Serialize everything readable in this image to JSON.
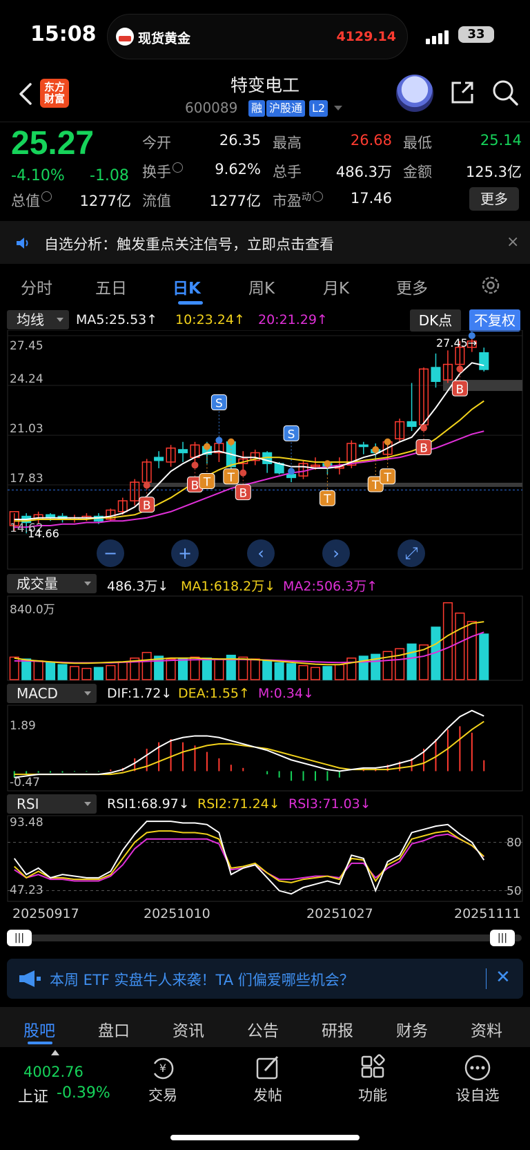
{
  "status_bar": {
    "time": "15:08",
    "ticker_name": "现货黄金",
    "ticker_price": "4129.14",
    "battery": "33"
  },
  "header": {
    "logo_text": "东方财富",
    "stock_name": "特变电工",
    "stock_code": "600089",
    "tags": [
      "融",
      "沪股通",
      "L2"
    ]
  },
  "quote": {
    "price": "25.27",
    "change_pct": "-4.10%",
    "change": "-1.08",
    "fields": [
      {
        "label": "今开",
        "value": "26.35",
        "tone": "white"
      },
      {
        "label": "最高",
        "value": "26.68",
        "tone": "red"
      },
      {
        "label": "最低",
        "value": "25.14",
        "tone": "green"
      },
      {
        "label": "换手",
        "value": "9.62%",
        "tone": "white"
      },
      {
        "label": "总手",
        "value": "486.3万",
        "tone": "white"
      },
      {
        "label": "金额",
        "value": "125.3亿",
        "tone": "white"
      },
      {
        "label": "总值",
        "value": "1277亿",
        "tone": "white"
      },
      {
        "label": "流值",
        "value": "1277亿",
        "tone": "white"
      },
      {
        "label": "市盈",
        "value": "17.46",
        "tone": "white",
        "superscript": "动"
      }
    ],
    "more_label": "更多"
  },
  "alert_banner": {
    "text": "自选分析：触发重点关注信号，立即点击查看",
    "close": "×"
  },
  "period_tabs": [
    "分时",
    "五日",
    "日K",
    "周K",
    "月K",
    "更多"
  ],
  "active_period": "日K",
  "ma_legend": {
    "selector": "均线",
    "ma5": "MA5:25.53↑",
    "ma10": "10:23.24↑",
    "ma20": "20:21.29↑",
    "dk_label": "DK点",
    "fq_label": "不复权"
  },
  "vol_legend": {
    "selector": "成交量",
    "vol": "486.3万↓",
    "ma1": "MA1:618.2万↓",
    "ma2": "MA2:506.3万↑",
    "axis_max": "840.0万"
  },
  "macd_legend": {
    "selector": "MACD",
    "dif": "DIF:1.72↓",
    "dea": "DEA:1.55↑",
    "m": "M:0.34↓",
    "axis_max": "1.89",
    "axis_min": "-0.47"
  },
  "rsi_legend": {
    "selector": "RSI",
    "rsi1": "RSI1:68.97↓",
    "rsi2": "RSI2:71.24↓",
    "rsi3": "RSI3:71.03↓",
    "axis_max": "93.48",
    "axis_min": "47.23",
    "level_high": "80",
    "level_low": "50"
  },
  "date_labels": [
    "20250917",
    "20251010",
    "20251027",
    "20251111"
  ],
  "colors": {
    "up": "#ff3b30",
    "down": "#22d3d3",
    "ma5": "#ffffff",
    "ma10": "#f2d21b",
    "ma20": "#e030d8",
    "accent": "#3c8cff"
  },
  "chart_data": {
    "type": "candlestick",
    "y_ticks": [
      "27.45",
      "24.24",
      "21.03",
      "17.83",
      "14.62"
    ],
    "ylim": [
      14.62,
      27.45
    ],
    "high_marker": "27.45→",
    "low_marker": "14.66",
    "signal_labels": {
      "buy": "B",
      "sell": "S",
      "t": "T"
    },
    "candles": [
      [
        15.2,
        16.1,
        14.8,
        16.0
      ],
      [
        15.8,
        15.4,
        14.7,
        16.0
      ],
      [
        15.6,
        15.9,
        15.3,
        16.1
      ],
      [
        15.9,
        15.7,
        15.5,
        16.0
      ],
      [
        15.8,
        15.6,
        15.4,
        16.0
      ],
      [
        15.6,
        15.7,
        15.4,
        15.9
      ],
      [
        15.7,
        15.8,
        15.5,
        16.0
      ],
      [
        15.8,
        15.5,
        15.3,
        16.0
      ],
      [
        15.6,
        16.2,
        15.5,
        16.3
      ],
      [
        16.1,
        16.8,
        15.9,
        17.0
      ],
      [
        16.8,
        18.0,
        16.5,
        18.2
      ],
      [
        18.0,
        19.3,
        17.8,
        19.5
      ],
      [
        19.6,
        19.4,
        18.9,
        20.0
      ],
      [
        19.3,
        20.2,
        19.0,
        20.4
      ],
      [
        20.1,
        19.9,
        19.3,
        20.6
      ],
      [
        19.6,
        20.4,
        19.1,
        20.6
      ],
      [
        20.3,
        19.8,
        19.2,
        20.6
      ],
      [
        19.9,
        20.5,
        19.3,
        20.7
      ],
      [
        20.6,
        19.0,
        18.8,
        20.7
      ],
      [
        19.2,
        19.5,
        18.6,
        20.0
      ],
      [
        19.4,
        19.9,
        19.1,
        20.1
      ],
      [
        19.9,
        19.2,
        18.6,
        20.0
      ],
      [
        19.2,
        18.6,
        18.5,
        19.3
      ],
      [
        18.5,
        18.3,
        18.0,
        18.7
      ],
      [
        18.4,
        19.2,
        18.2,
        19.4
      ],
      [
        19.1,
        19.1,
        18.8,
        19.6
      ],
      [
        19.2,
        19.0,
        18.5,
        19.4
      ],
      [
        18.9,
        19.0,
        18.5,
        19.6
      ],
      [
        19.1,
        20.5,
        18.9,
        20.7
      ],
      [
        20.4,
        20.3,
        19.8,
        20.6
      ],
      [
        20.1,
        19.9,
        19.4,
        20.5
      ],
      [
        19.8,
        20.6,
        19.5,
        20.8
      ],
      [
        20.8,
        21.9,
        20.6,
        22.1
      ],
      [
        21.9,
        21.6,
        21.3,
        24.4
      ],
      [
        21.7,
        25.3,
        21.5,
        25.4
      ],
      [
        25.4,
        24.5,
        24.1,
        26.3
      ],
      [
        24.6,
        25.6,
        24.4,
        26.5
      ],
      [
        25.6,
        26.7,
        25.3,
        27.1
      ],
      [
        26.7,
        27.1,
        26.4,
        27.45
      ],
      [
        26.35,
        25.27,
        25.14,
        26.68
      ]
    ],
    "ma5": [
      15.6,
      15.6,
      15.7,
      15.7,
      15.7,
      15.7,
      15.7,
      15.7,
      15.8,
      16.0,
      16.4,
      17.1,
      17.9,
      18.7,
      19.2,
      19.6,
      19.9,
      20.0,
      19.8,
      19.6,
      19.6,
      19.4,
      19.2,
      19.0,
      19.0,
      18.9,
      18.9,
      19.0,
      19.3,
      19.6,
      19.8,
      20.2,
      20.6,
      20.9,
      21.8,
      22.8,
      23.9,
      25.0,
      25.7,
      25.53
    ],
    "ma10": [
      15.5,
      15.5,
      15.6,
      15.6,
      15.6,
      15.6,
      15.6,
      15.7,
      15.7,
      15.8,
      15.9,
      16.2,
      16.6,
      17.0,
      17.5,
      18.0,
      18.4,
      18.8,
      19.1,
      19.3,
      19.5,
      19.6,
      19.6,
      19.5,
      19.4,
      19.3,
      19.3,
      19.3,
      19.3,
      19.4,
      19.5,
      19.6,
      19.8,
      20.0,
      20.3,
      20.8,
      21.4,
      22.0,
      22.7,
      23.24
    ],
    "ma20": [
      15.1,
      15.1,
      15.2,
      15.2,
      15.3,
      15.3,
      15.4,
      15.4,
      15.5,
      15.5,
      15.6,
      15.7,
      15.9,
      16.1,
      16.4,
      16.7,
      17.0,
      17.3,
      17.6,
      17.8,
      18.0,
      18.2,
      18.4,
      18.6,
      18.7,
      18.9,
      19.0,
      19.1,
      19.2,
      19.3,
      19.4,
      19.5,
      19.6,
      19.8,
      20.0,
      20.2,
      20.5,
      20.8,
      21.1,
      21.29
    ],
    "volume": [
      240,
      220,
      200,
      190,
      160,
      140,
      120,
      130,
      150,
      190,
      230,
      290,
      250,
      220,
      230,
      240,
      230,
      220,
      260,
      240,
      220,
      200,
      180,
      170,
      150,
      130,
      140,
      160,
      230,
      250,
      270,
      300,
      330,
      380,
      370,
      560,
      820,
      710,
      620,
      486.3
    ],
    "vol_ma1": [
      230,
      210,
      200,
      190,
      180,
      175,
      175,
      180,
      185,
      190,
      200,
      210,
      220,
      230,
      230,
      230,
      225,
      220,
      220,
      220,
      215,
      205,
      195,
      185,
      175,
      165,
      160,
      160,
      180,
      200,
      220,
      240,
      260,
      290,
      320,
      380,
      470,
      540,
      600,
      618.2
    ],
    "vol_ma2": [
      200,
      200,
      195,
      190,
      185,
      180,
      180,
      180,
      180,
      185,
      190,
      195,
      200,
      205,
      210,
      212,
      215,
      215,
      215,
      215,
      212,
      210,
      205,
      200,
      195,
      190,
      185,
      182,
      185,
      190,
      195,
      205,
      215,
      230,
      250,
      290,
      340,
      400,
      460,
      506.3
    ],
    "macd_dif": [
      -0.2,
      -0.15,
      -0.1,
      -0.1,
      -0.1,
      -0.1,
      -0.1,
      -0.1,
      -0.05,
      0.05,
      0.25,
      0.5,
      0.75,
      0.95,
      1.05,
      1.1,
      1.1,
      1.05,
      0.95,
      0.85,
      0.75,
      0.65,
      0.5,
      0.35,
      0.25,
      0.15,
      0.05,
      0.0,
      0.05,
      0.1,
      0.1,
      0.15,
      0.25,
      0.35,
      0.6,
      0.95,
      1.35,
      1.7,
      1.89,
      1.72
    ],
    "macd_dea": [
      -0.1,
      -0.1,
      -0.1,
      -0.1,
      -0.1,
      -0.1,
      -0.1,
      -0.1,
      -0.1,
      -0.05,
      0.05,
      0.15,
      0.3,
      0.45,
      0.6,
      0.7,
      0.8,
      0.85,
      0.85,
      0.8,
      0.75,
      0.7,
      0.6,
      0.5,
      0.4,
      0.3,
      0.2,
      0.1,
      0.05,
      0.05,
      0.05,
      0.05,
      0.1,
      0.15,
      0.25,
      0.45,
      0.7,
      1.0,
      1.3,
      1.55
    ],
    "macd_m": [
      -0.2,
      -0.1,
      -0.05,
      -0.05,
      -0.05,
      -0.02,
      -0.02,
      -0.02,
      0.05,
      0.1,
      0.4,
      0.7,
      0.9,
      1.0,
      0.9,
      0.8,
      0.6,
      0.4,
      0.2,
      0.1,
      0.0,
      -0.1,
      -0.2,
      -0.3,
      -0.3,
      -0.3,
      -0.3,
      -0.2,
      0.0,
      0.1,
      0.1,
      0.2,
      0.3,
      0.4,
      0.7,
      1.0,
      1.3,
      1.4,
      1.2,
      0.34
    ],
    "rsi1": [
      70,
      60,
      64,
      58,
      60,
      59,
      58,
      58,
      62,
      75,
      85,
      93,
      93,
      93,
      92,
      92,
      91,
      86,
      60,
      64,
      66,
      58,
      50,
      48,
      52,
      54,
      56,
      54,
      72,
      70,
      50,
      68,
      72,
      86,
      88,
      90,
      91,
      85,
      80,
      68.97
    ],
    "rsi2": [
      65,
      58,
      62,
      58,
      58,
      57,
      57,
      57,
      60,
      70,
      80,
      86,
      87,
      87,
      86,
      86,
      85,
      82,
      64,
      65,
      67,
      61,
      56,
      55,
      57,
      58,
      59,
      57,
      70,
      69,
      56,
      66,
      70,
      82,
      84,
      86,
      87,
      82,
      78,
      71.24
    ],
    "rsi3": [
      63,
      58,
      60,
      57,
      57,
      56,
      56,
      56,
      59,
      66,
      76,
      82,
      82,
      82,
      82,
      82,
      82,
      79,
      63,
      64,
      66,
      61,
      57,
      57,
      58,
      59,
      59,
      58,
      67,
      67,
      58,
      64,
      68,
      79,
      81,
      84,
      85,
      82,
      78,
      71.03
    ],
    "rsi_ylim": [
      47.23,
      93.48
    ],
    "signals": [
      {
        "index": 11,
        "type": "B"
      },
      {
        "index": 15,
        "type": "B"
      },
      {
        "index": 19,
        "type": "B"
      },
      {
        "index": 17,
        "type": "S"
      },
      {
        "index": 23,
        "type": "S"
      },
      {
        "index": 38,
        "type": "S"
      },
      {
        "index": 16,
        "type": "T"
      },
      {
        "index": 18,
        "type": "T"
      },
      {
        "index": 26,
        "type": "T"
      },
      {
        "index": 30,
        "type": "T"
      },
      {
        "index": 31,
        "type": "T"
      },
      {
        "index": 34,
        "type": "B"
      },
      {
        "index": 37,
        "type": "B"
      }
    ]
  },
  "etf_banner": {
    "text": "本周 ETF 实盘牛人来袭！TA 们偏爱哪些机会？",
    "close": "✕"
  },
  "bottom_tabs": [
    "股吧",
    "盘口",
    "资讯",
    "公告",
    "研报",
    "财务",
    "资料"
  ],
  "index_widget": {
    "value": "4002.76",
    "name": "上证",
    "change": "-0.39%"
  },
  "toolbar": [
    {
      "label": "交易",
      "icon": "trade-icon"
    },
    {
      "label": "发帖",
      "icon": "post-icon"
    },
    {
      "label": "功能",
      "icon": "grid-icon"
    },
    {
      "label": "设自选",
      "icon": "more-dots-icon"
    }
  ]
}
